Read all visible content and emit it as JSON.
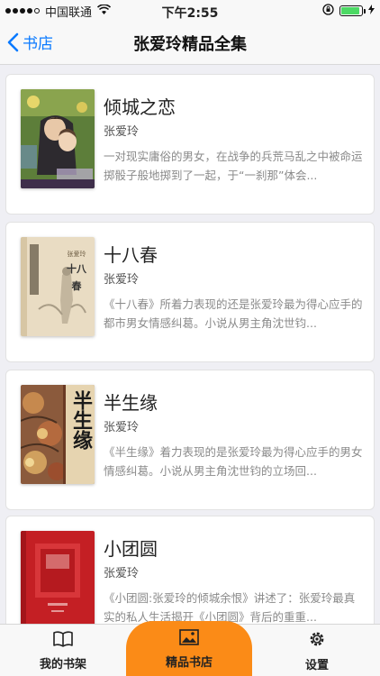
{
  "status_bar": {
    "carrier": "中国联通",
    "time": "下午2:55",
    "battery_level": 0.9
  },
  "nav": {
    "back_label": "书店",
    "title": "张爱玲精品全集"
  },
  "books": [
    {
      "title": "倾城之恋",
      "author": "张爱玲",
      "description": "一对现实庸俗的男女，在战争的兵荒马乱之中被命运掷骰子般地掷到了一起，于“一刹那”体会..."
    },
    {
      "title": "十八春",
      "author": "张爱玲",
      "description": "《十八春》所着力表现的还是张爱玲最为得心应手的都市男女情感纠葛。小说从男主角沈世钧..."
    },
    {
      "title": "半生缘",
      "author": "张爱玲",
      "description": "《半生缘》着力表现的是张爱玲最为得心应手的男女情感纠葛。小说从男主角沈世钧的立场回..."
    },
    {
      "title": "小团圆",
      "author": "张爱玲",
      "description": "《小团圆:张爱玲的倾城余恨》讲述了：张爱玲最真实的私人生活揭开《小团圆》背后的重重..."
    }
  ],
  "covers": {
    "cover2_text": "十八春",
    "cover3_text": "半生缘"
  },
  "tabs": {
    "bookshelf": "我的书架",
    "store": "精品书店",
    "settings": "设置"
  },
  "colors": {
    "accent": "#0a7aff",
    "tab_highlight": "#fb8b17"
  }
}
